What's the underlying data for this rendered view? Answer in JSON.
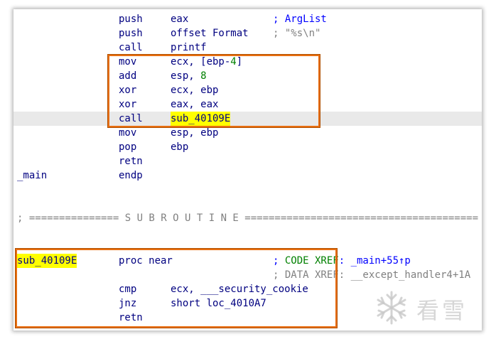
{
  "lines": [
    {
      "mnemonic": "push",
      "operand": "eax",
      "comment": "; ArgList"
    },
    {
      "mnemonic": "push",
      "operand": "offset Format",
      "comment": ";",
      "comment_value": "\"%s\\n\""
    },
    {
      "mnemonic": "call",
      "operand": "printf"
    },
    {
      "mnemonic": "mov",
      "operand_pre": "ecx, [ebp-",
      "operand_num": "4",
      "operand_post": "]"
    },
    {
      "mnemonic": "add",
      "operand_pre": "esp, ",
      "operand_num": "8"
    },
    {
      "mnemonic": "xor",
      "operand": "ecx, ebp"
    },
    {
      "mnemonic": "xor",
      "operand": "eax, eax"
    },
    {
      "mnemonic": "call",
      "operand": "sub_40109E"
    },
    {
      "mnemonic": "mov",
      "operand": "esp, ebp"
    },
    {
      "mnemonic": "pop",
      "operand": "ebp"
    },
    {
      "mnemonic": "retn"
    },
    {
      "label": "_main",
      "mnemonic": "endp"
    },
    {
      "separator": "; =============== S U B R O U T I N E ======================================="
    },
    {
      "label": "sub_40109E",
      "mnemonic": "proc near",
      "comment_pre": "; ",
      "comment_green": "CODE XREF",
      "comment_post": ": _main+55↑p"
    },
    {
      "comment_pre": "; ",
      "comment_green": "DATA XREF",
      "comment_post": ": __except_handler4+1A"
    },
    {
      "mnemonic": "cmp",
      "operand": "ecx, ___security_cookie"
    },
    {
      "mnemonic": "jnz",
      "operand": "short loc_4010A7"
    },
    {
      "mnemonic": "retn"
    }
  ],
  "colors": {
    "highlight_box": "#e86e10",
    "current_line": "#e9e9e9",
    "symbol_highlight": "#ffff00",
    "code_text": "#000080",
    "comment": "#0000ff",
    "number": "#008000",
    "separator": "#808080"
  },
  "watermark": {
    "icon": "snowflake-icon",
    "text": "看雪"
  }
}
